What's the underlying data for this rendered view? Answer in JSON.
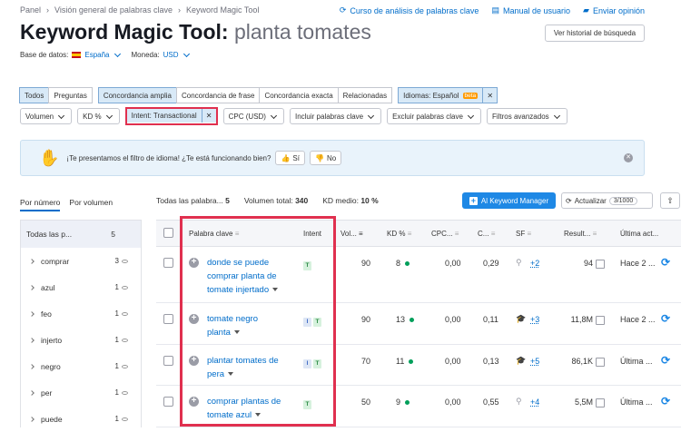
{
  "breadcrumb": [
    "Panel",
    "Visión general de palabras clave",
    "Keyword Magic Tool"
  ],
  "top_links": [
    "Curso de análisis de palabras clave",
    "Manual de usuario",
    "Enviar opinión"
  ],
  "title": "Keyword Magic Tool:",
  "query": "planta tomates",
  "history_button": "Ver historial de búsqueda",
  "database_label": "Base de datos:",
  "database_value": "España",
  "currency_label": "Moneda:",
  "currency_value": "USD",
  "filters_row1": {
    "group1": [
      "Todos",
      "Preguntas"
    ],
    "group2": [
      "Concordancia amplia",
      "Concordancia de frase",
      "Concordancia exacta",
      "Relacionadas"
    ],
    "language": "Idiomas: Español",
    "beta": "beta",
    "close": "✕"
  },
  "filters_row2": {
    "volume": "Volumen",
    "kd": "KD %",
    "intent": "Intent: Transactional",
    "close": "✕",
    "cpc": "CPC (USD)",
    "include": "Incluir palabras clave",
    "exclude": "Excluir palabras clave",
    "advanced": "Filtros avanzados"
  },
  "banner": {
    "text": "¡Te presentamos el filtro de idioma! ¿Te está funcionando bien?",
    "yes": "Sí",
    "no": "No"
  },
  "side_tabs": [
    "Por número",
    "Por volumen"
  ],
  "stats": {
    "all_label": "Todas las palabra...",
    "all_value": "5",
    "volume_label": "Volumen total:",
    "volume_value": "340",
    "kd_label": "KD medio:",
    "kd_value": "10 %"
  },
  "add_button": "Al Keyword Manager",
  "update_button": "Actualizar",
  "update_count": "3/1000",
  "sidebar": {
    "header": "Todas las p...",
    "header_count": "5",
    "items": [
      {
        "label": "comprar",
        "count": "3"
      },
      {
        "label": "azul",
        "count": "1"
      },
      {
        "label": "feo",
        "count": "1"
      },
      {
        "label": "injerto",
        "count": "1"
      },
      {
        "label": "negro",
        "count": "1"
      },
      {
        "label": "per",
        "count": "1"
      },
      {
        "label": "puede",
        "count": "1"
      }
    ]
  },
  "columns": [
    "Palabra clave",
    "Intent",
    "Vol...",
    "KD %",
    "CPC...",
    "C...",
    "SF",
    "Result...",
    "Última act..."
  ],
  "rows": [
    {
      "keyword": [
        "donde se puede",
        "comprar planta de",
        "tomate injertado"
      ],
      "intents": [
        "T"
      ],
      "volume": "90",
      "kd": "8",
      "cpc": "0,00",
      "com": "0,29",
      "sf": "+2",
      "results": "94",
      "updated": "Hace 2 ..."
    },
    {
      "keyword": [
        "tomate negro",
        "planta"
      ],
      "intents": [
        "I",
        "T"
      ],
      "volume": "90",
      "kd": "13",
      "cpc": "0,00",
      "com": "0,11",
      "sf": "+3",
      "results": "11,8M",
      "updated": "Hace 2 ..."
    },
    {
      "keyword": [
        "plantar tomates de",
        "pera"
      ],
      "intents": [
        "I",
        "T"
      ],
      "volume": "70",
      "kd": "11",
      "cpc": "0,00",
      "com": "0,13",
      "sf": "+5",
      "results": "86,1K",
      "updated": "Última ..."
    },
    {
      "keyword": [
        "comprar plantas de",
        "tomate azul"
      ],
      "intents": [
        "T"
      ],
      "volume": "50",
      "kd": "9",
      "cpc": "0,00",
      "com": "0,55",
      "sf": "+4",
      "results": "5,5M",
      "updated": "Última ..."
    }
  ],
  "colors": {
    "accent": "#006dca",
    "highlight": "#e0304f",
    "kd_easy": "#009f5a"
  }
}
